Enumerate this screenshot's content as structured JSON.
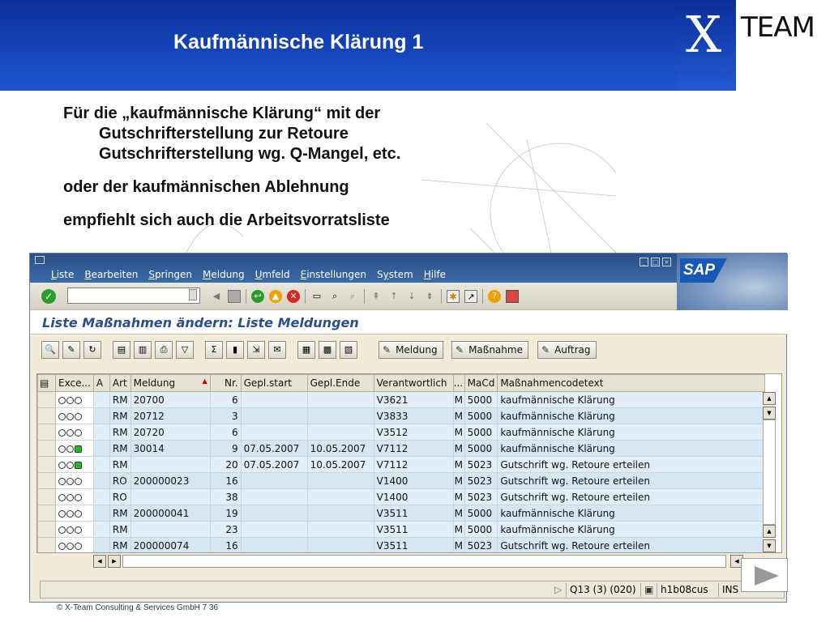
{
  "slide": {
    "title": "Kaufmännische Klärung 1",
    "logo_text": "TEAM",
    "logo_letter": "X",
    "lines": [
      "Für die „kaufmännische Klärung“ mit der",
      "Gutschrifterstellung zur Retoure",
      "Gutschrifterstellung wg. Q-Mangel, etc.",
      "oder der kaufmännischen Ablehnung",
      "empfiehlt sich auch die Arbeitsvorratsliste"
    ],
    "footer": "©  X-Team Consulting & Services GmbH  7 36"
  },
  "sap": {
    "menus": [
      {
        "label": "Liste",
        "key": "L"
      },
      {
        "label": "Bearbeiten",
        "key": "B"
      },
      {
        "label": "Springen",
        "key": "S"
      },
      {
        "label": "Meldung",
        "key": "M"
      },
      {
        "label": "Umfeld",
        "key": "U"
      },
      {
        "label": "Einstellungen",
        "key": "E"
      },
      {
        "label": "System",
        "key": "y"
      },
      {
        "label": "Hilfe",
        "key": "H"
      }
    ],
    "logo": "SAP",
    "screen_title": "Liste Maßnahmen ändern: Liste Meldungen",
    "buttons": {
      "meldung": "Meldung",
      "massnahme": "Maßnahme",
      "auftrag": "Auftrag"
    },
    "columns": [
      "Exce...",
      "A",
      "Art",
      "Meldung",
      "Nr.",
      "Gepl.start",
      "Gepl.Ende",
      "Verantwortlich",
      "...",
      "MaCd",
      "Maßnahmencodetext"
    ],
    "rows": [
      {
        "lights": "ooo",
        "art": "RM",
        "meldung": "20700",
        "nr": "6",
        "start": "",
        "ende": "",
        "verant": "V3621",
        "x": "M",
        "macd": "5000",
        "text": "kaufmännische Klärung"
      },
      {
        "lights": "ooo",
        "art": "RM",
        "meldung": "20712",
        "nr": "3",
        "start": "",
        "ende": "",
        "verant": "V3833",
        "x": "M",
        "macd": "5000",
        "text": "kaufmännische Klärung"
      },
      {
        "lights": "ooo",
        "art": "RM",
        "meldung": "20720",
        "nr": "6",
        "start": "",
        "ende": "",
        "verant": "V3512",
        "x": "M",
        "macd": "5000",
        "text": "kaufmännische Klärung"
      },
      {
        "lights": "oog",
        "art": "RM",
        "meldung": "30014",
        "nr": "9",
        "start": "07.05.2007",
        "ende": "10.05.2007",
        "verant": "V7112",
        "x": "M",
        "macd": "5000",
        "text": "kaufmännische Klärung"
      },
      {
        "lights": "oog",
        "art": "RM",
        "meldung": "",
        "nr": "20",
        "start": "07.05.2007",
        "ende": "10.05.2007",
        "verant": "V7112",
        "x": "M",
        "macd": "5023",
        "text": "Gutschrift wg. Retoure erteilen"
      },
      {
        "lights": "ooo",
        "art": "RO",
        "meldung": "200000023",
        "nr": "16",
        "start": "",
        "ende": "",
        "verant": "V1400",
        "x": "M",
        "macd": "5023",
        "text": "Gutschrift wg. Retoure erteilen"
      },
      {
        "lights": "ooo",
        "art": "RO",
        "meldung": "",
        "nr": "38",
        "start": "",
        "ende": "",
        "verant": "V1400",
        "x": "M",
        "macd": "5023",
        "text": "Gutschrift wg. Retoure erteilen"
      },
      {
        "lights": "ooo",
        "art": "RM",
        "meldung": "200000041",
        "nr": "19",
        "start": "",
        "ende": "",
        "verant": "V3511",
        "x": "M",
        "macd": "5000",
        "text": "kaufmännische Klärung"
      },
      {
        "lights": "ooo",
        "art": "RM",
        "meldung": "",
        "nr": "23",
        "start": "",
        "ende": "",
        "verant": "V3511",
        "x": "M",
        "macd": "5000",
        "text": "kaufmännische Klärung"
      },
      {
        "lights": "ooo",
        "art": "RM",
        "meldung": "200000074",
        "nr": "16",
        "start": "",
        "ende": "",
        "verant": "V3511",
        "x": "M",
        "macd": "5023",
        "text": "Gutschrift wg. Retoure erteilen"
      }
    ],
    "status": {
      "system": "Q13 (3) (020)",
      "host": "h1b08cus",
      "mode": "INS"
    }
  }
}
